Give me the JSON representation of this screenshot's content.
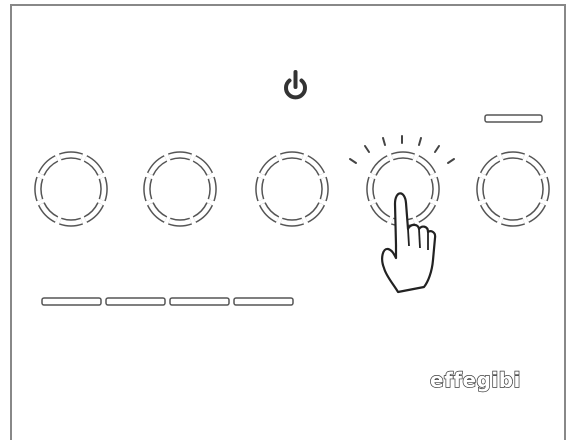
{
  "device": {
    "brand_logo": "effegibi",
    "power_icon": "power-icon",
    "hint_icon": "hand-pointer-icon",
    "pressed_button_index": 3,
    "speed_buttons": [
      {
        "id": "speed-button-1"
      },
      {
        "id": "speed-button-2"
      },
      {
        "id": "speed-button-3"
      },
      {
        "id": "speed-button-4"
      },
      {
        "id": "light-button"
      }
    ],
    "level_indicator_count": 4,
    "status_indicator_count": 1
  },
  "colors": {
    "outline": "#555555",
    "frame": "#888888",
    "background": "#ffffff"
  }
}
